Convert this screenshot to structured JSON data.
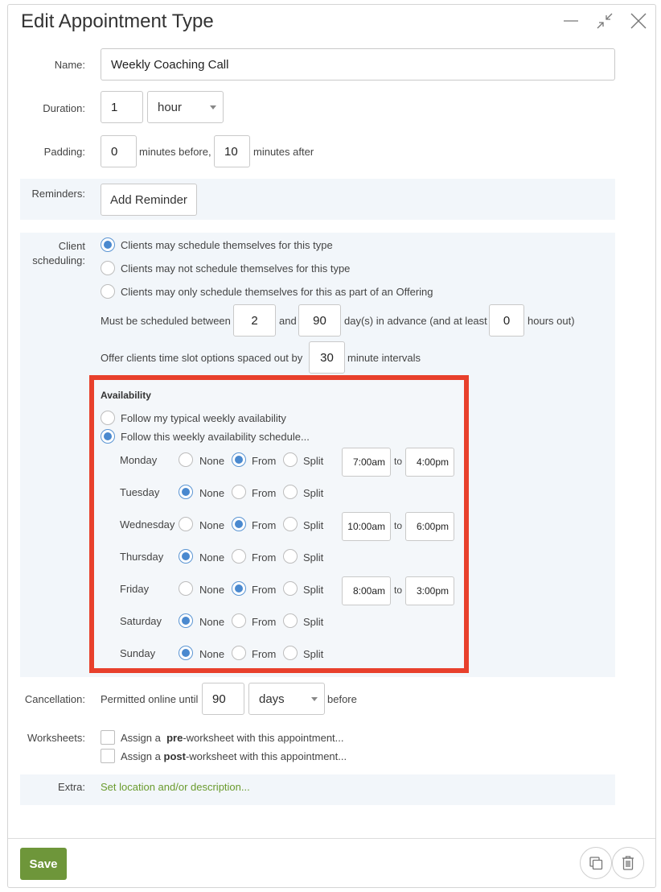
{
  "dialog": {
    "title": "Edit Appointment Type"
  },
  "name": {
    "label": "Name:",
    "value": "Weekly Coaching Call"
  },
  "duration": {
    "label": "Duration:",
    "value": "1",
    "unit": "hour"
  },
  "padding": {
    "label": "Padding:",
    "before_value": "0",
    "before_text": "minutes before,",
    "after_value": "10",
    "after_text": "minutes after"
  },
  "reminders": {
    "label": "Reminders:",
    "button": "Add Reminder"
  },
  "client_scheduling": {
    "label_line1": "Client",
    "label_line2": "scheduling:",
    "options": [
      {
        "label": "Clients may schedule themselves for this type",
        "selected": true
      },
      {
        "label": "Clients may not schedule themselves for this type",
        "selected": false
      },
      {
        "label": "Clients may only schedule themselves for this as part of an Offering",
        "selected": false
      }
    ],
    "advance_prefix": "Must be scheduled between",
    "advance_min": "2",
    "advance_and": "and",
    "advance_max": "90",
    "advance_suffix": "day(s) in advance (and at least",
    "hours_out": "0",
    "hours_out_suffix": "hours out)",
    "slot_prefix": "Offer clients time slot options spaced out by",
    "slot_value": "30",
    "slot_suffix": "minute intervals"
  },
  "availability": {
    "heading": "Availability",
    "options": [
      {
        "label": "Follow my typical weekly availability",
        "selected": false
      },
      {
        "label": "Follow this weekly availability schedule...",
        "selected": true
      }
    ],
    "choice_labels": {
      "none": "None",
      "from": "From",
      "split": "Split"
    },
    "to_label": "to",
    "days": [
      {
        "name": "Monday",
        "mode": "from",
        "start": "7:00am",
        "end": "4:00pm"
      },
      {
        "name": "Tuesday",
        "mode": "none"
      },
      {
        "name": "Wednesday",
        "mode": "from",
        "start": "10:00am",
        "end": "6:00pm"
      },
      {
        "name": "Thursday",
        "mode": "none"
      },
      {
        "name": "Friday",
        "mode": "from",
        "start": "8:00am",
        "end": "3:00pm"
      },
      {
        "name": "Saturday",
        "mode": "none"
      },
      {
        "name": "Sunday",
        "mode": "none"
      }
    ]
  },
  "cancellation": {
    "label": "Cancellation:",
    "prefix": "Permitted online until",
    "value": "90",
    "unit": "days",
    "suffix": "before"
  },
  "worksheets": {
    "label": "Worksheets:",
    "pre_prefix": "Assign a",
    "pre_bold": "pre",
    "pre_suffix": "-worksheet with this appointment...",
    "post_prefix": "Assign a",
    "post_bold": "post",
    "post_suffix": "-worksheet with this appointment..."
  },
  "extra": {
    "label": "Extra:",
    "link": "Set location and/or description..."
  },
  "footer": {
    "save": "Save"
  },
  "colors": {
    "accent_green": "#6e963a",
    "link_green": "#6a9b2e",
    "radio_blue": "#4a89cf",
    "highlight_red": "#e8402c",
    "band_bg": "#f2f6fa"
  }
}
